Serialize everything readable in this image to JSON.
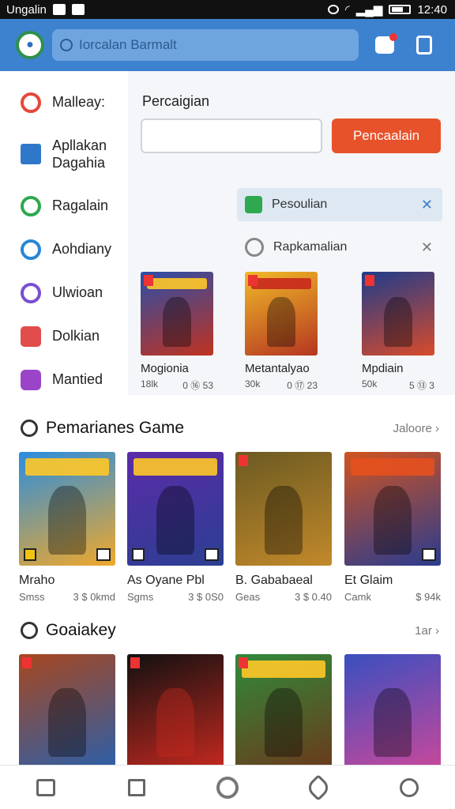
{
  "status_bar": {
    "carrier": "Ungalin",
    "time": "12:40"
  },
  "header": {
    "search_placeholder": "Iorcalan Barmalt"
  },
  "sidebar": {
    "items": [
      {
        "label": "Malleay:",
        "color": "#e5483a"
      },
      {
        "label": "Apllakan\nDagahia",
        "color": "#2f78c9"
      },
      {
        "label": "Ragalain",
        "color": "#2fa84f"
      },
      {
        "label": "Aohdiany",
        "color": "#2a86d6"
      },
      {
        "label": "Ulwioan",
        "color": "#7a4fd0"
      },
      {
        "label": "Dolkian",
        "color": "#e14c4c"
      },
      {
        "label": "Mantied",
        "color": "#9a45c8"
      }
    ]
  },
  "panel": {
    "title": "Percaigian",
    "button_label": "Pencaalain",
    "chip_a": "Pesoulian",
    "chip_b": "Rapkamalian"
  },
  "mini_cards": [
    {
      "name": "Mogionia",
      "meta_left": "18lk",
      "meta_right": "0 ⑯ 53",
      "colors": [
        "#2b4ea8",
        "#c0321f"
      ]
    },
    {
      "name": "Metantalyao",
      "meta_left": "30k",
      "meta_right": "0 ⑰ 23",
      "colors": [
        "#f0b928",
        "#b53621"
      ]
    },
    {
      "name": "Mpdiain",
      "meta_left": "50k",
      "meta_right": "5 ⑬ 3",
      "colors": [
        "#1e3c8c",
        "#d84b2a"
      ]
    }
  ],
  "section1": {
    "title": "Pemarianes Game",
    "more": "Jaloore"
  },
  "section1_cards": [
    {
      "name": "Mraho",
      "meta_left": "Smss",
      "meta_right": "3 $ 0kmd",
      "colors": [
        "#2a8de0",
        "#f0a82a"
      ]
    },
    {
      "name": "As Oyane Pbl",
      "meta_left": "Sgms",
      "meta_right": "3 $ 0S0",
      "colors": [
        "#5b2ba8",
        "#2b3f92"
      ]
    },
    {
      "name": "B. Gababaeal",
      "meta_left": "Geas",
      "meta_right": "3 $ 0.40",
      "colors": [
        "#6b5a22",
        "#c2892a"
      ]
    },
    {
      "name": "Et Glaim",
      "meta_left": "Camk",
      "meta_right": "$ 94k",
      "colors": [
        "#d0541f",
        "#2a3b8f"
      ]
    }
  ],
  "section2": {
    "title": "Goaiakey",
    "more": "1ar"
  },
  "section2_cards": [
    {
      "colors": [
        "#a7471f",
        "#2d5fa8"
      ]
    },
    {
      "colors": [
        "#111111",
        "#c2281f"
      ]
    },
    {
      "colors": [
        "#2f8a3b",
        "#6b3a1c"
      ]
    },
    {
      "colors": [
        "#3a4fbf",
        "#c7489b"
      ]
    }
  ]
}
